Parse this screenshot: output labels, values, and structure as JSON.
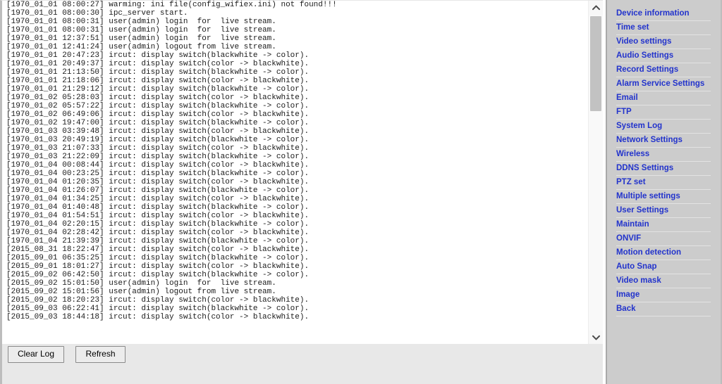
{
  "log": {
    "lines": [
      "[1970_01_01 08:00:27] warming: ini file(config_wifiex.ini) not found!!!",
      "[1970_01_01 08:00:30] ipc_server start.",
      "[1970_01_01 08:00:31] user(admin) login  for  live stream.",
      "[1970_01_01 08:00:31] user(admin) login  for  live stream.",
      "[1970_01_01 12:37:51] user(admin) login  for  live stream.",
      "[1970_01_01 12:41:24] user(admin) logout from live stream.",
      "[1970_01_01 20:47:23] ircut: display switch(blackwhite -> color).",
      "[1970_01_01 20:49:37] ircut: display switch(color -> blackwhite).",
      "[1970_01_01 21:13:50] ircut: display switch(blackwhite -> color).",
      "[1970_01_01 21:18:06] ircut: display switch(color -> blackwhite).",
      "[1970_01_01 21:29:12] ircut: display switch(blackwhite -> color).",
      "[1970_01_02 05:28:03] ircut: display switch(color -> blackwhite).",
      "[1970_01_02 05:57:22] ircut: display switch(blackwhite -> color).",
      "[1970_01_02 06:49:06] ircut: display switch(color -> blackwhite).",
      "[1970_01_02 19:47:00] ircut: display switch(blackwhite -> color).",
      "[1970_01_03 03:39:48] ircut: display switch(color -> blackwhite).",
      "[1970_01_03 20:49:19] ircut: display switch(blackwhite -> color).",
      "[1970_01_03 21:07:33] ircut: display switch(color -> blackwhite).",
      "[1970_01_03 21:22:09] ircut: display switch(blackwhite -> color).",
      "[1970_01_04 00:08:44] ircut: display switch(color -> blackwhite).",
      "[1970_01_04 00:23:25] ircut: display switch(blackwhite -> color).",
      "[1970_01_04 01:20:35] ircut: display switch(color -> blackwhite).",
      "[1970_01_04 01:26:07] ircut: display switch(blackwhite -> color).",
      "[1970_01_04 01:34:25] ircut: display switch(color -> blackwhite).",
      "[1970_01_04 01:40:48] ircut: display switch(blackwhite -> color).",
      "[1970_01_04 01:54:51] ircut: display switch(color -> blackwhite).",
      "[1970_01_04 02:20:15] ircut: display switch(blackwhite -> color).",
      "[1970_01_04 02:28:42] ircut: display switch(color -> blackwhite).",
      "[1970_01_04 21:39:39] ircut: display switch(blackwhite -> color).",
      "[2015_08_31 18:22:47] ircut: display switch(color -> blackwhite).",
      "[2015_09_01 06:35:25] ircut: display switch(blackwhite -> color).",
      "[2015_09_01 18:01:27] ircut: display switch(color -> blackwhite).",
      "[2015_09_02 06:42:50] ircut: display switch(blackwhite -> color).",
      "[2015_09_02 15:01:50] user(admin) login  for  live stream.",
      "[2015_09_02 15:01:56] user(admin) logout from live stream.",
      "[2015_09_02 18:20:23] ircut: display switch(color -> blackwhite).",
      "[2015_09_03 06:22:41] ircut: display switch(blackwhite -> color).",
      "[2015_09_03 18:44:18] ircut: display switch(color -> blackwhite)."
    ]
  },
  "scrollbar": {
    "up_icon": "chevron-up-icon",
    "down_icon": "chevron-down-icon"
  },
  "buttons": {
    "clear_log": "Clear Log",
    "refresh": "Refresh"
  },
  "menu": {
    "items": [
      {
        "label": "Device information"
      },
      {
        "label": "Time set"
      },
      {
        "label": "Video settings"
      },
      {
        "label": "Audio Settings"
      },
      {
        "label": "Record Settings"
      },
      {
        "label": "Alarm Service Settings"
      },
      {
        "label": "Email"
      },
      {
        "label": "FTP"
      },
      {
        "label": "System Log"
      },
      {
        "label": "Network Settings"
      },
      {
        "label": "Wireless"
      },
      {
        "label": "DDNS Settings"
      },
      {
        "label": "PTZ set"
      },
      {
        "label": "Multiple settings"
      },
      {
        "label": "User Settings"
      },
      {
        "label": "Maintain"
      },
      {
        "label": "ONVIF"
      },
      {
        "label": "Motion detection"
      },
      {
        "label": "Auto Snap"
      },
      {
        "label": "Video mask"
      },
      {
        "label": "Image"
      },
      {
        "label": "Back"
      }
    ]
  },
  "colors": {
    "menu_link": "#2233cc",
    "menu_background": "#cccccc",
    "log_background": "#ffffff",
    "panel_background": "#e8e8e8"
  }
}
